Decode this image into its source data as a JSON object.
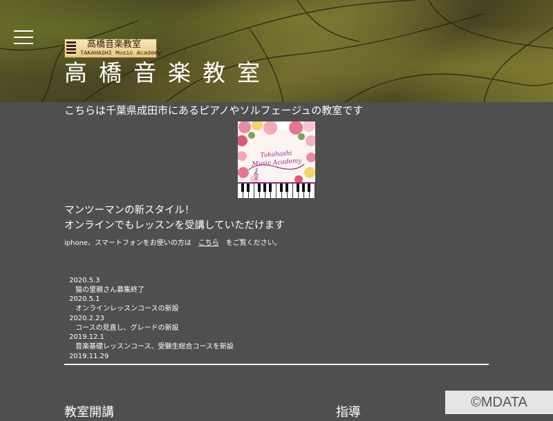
{
  "header": {
    "logo_jp": "高橋音楽教室",
    "logo_en": "TAKAHASHI Music Academy",
    "title": "高橋音楽教室",
    "menu_icon": "hamburger-menu-icon"
  },
  "intro": "こちらは千葉県成田市にあるピアノやソルフェージュの教室です",
  "academy_image": {
    "line1": "Takahashi",
    "line2": "Music Academy"
  },
  "catch": {
    "line1": "マンツーマンの新スタイル！",
    "line2": "オンラインでもレッスンを受講していただけます"
  },
  "iphone_note": {
    "before": "iphone、スマートフォンをお使いの方は",
    "link": "こちら",
    "after": "をご覧ください。"
  },
  "news": [
    {
      "date": "2020.5.3",
      "text": "猫の里親さん募集終了"
    },
    {
      "date": "2020.5.1",
      "text": "オンラインレッスンコースの新設"
    },
    {
      "date": "2020.2.23",
      "text": "コースの見直し、グレードの新設"
    },
    {
      "date": "2019.12.1",
      "text": "音楽基礎レッスンコース、受験生総合コースを新設"
    },
    {
      "date": "2019.11.29",
      "text": ""
    }
  ],
  "sections": {
    "left": "教室開講",
    "right": "指導"
  },
  "watermark": "©MDATA"
}
